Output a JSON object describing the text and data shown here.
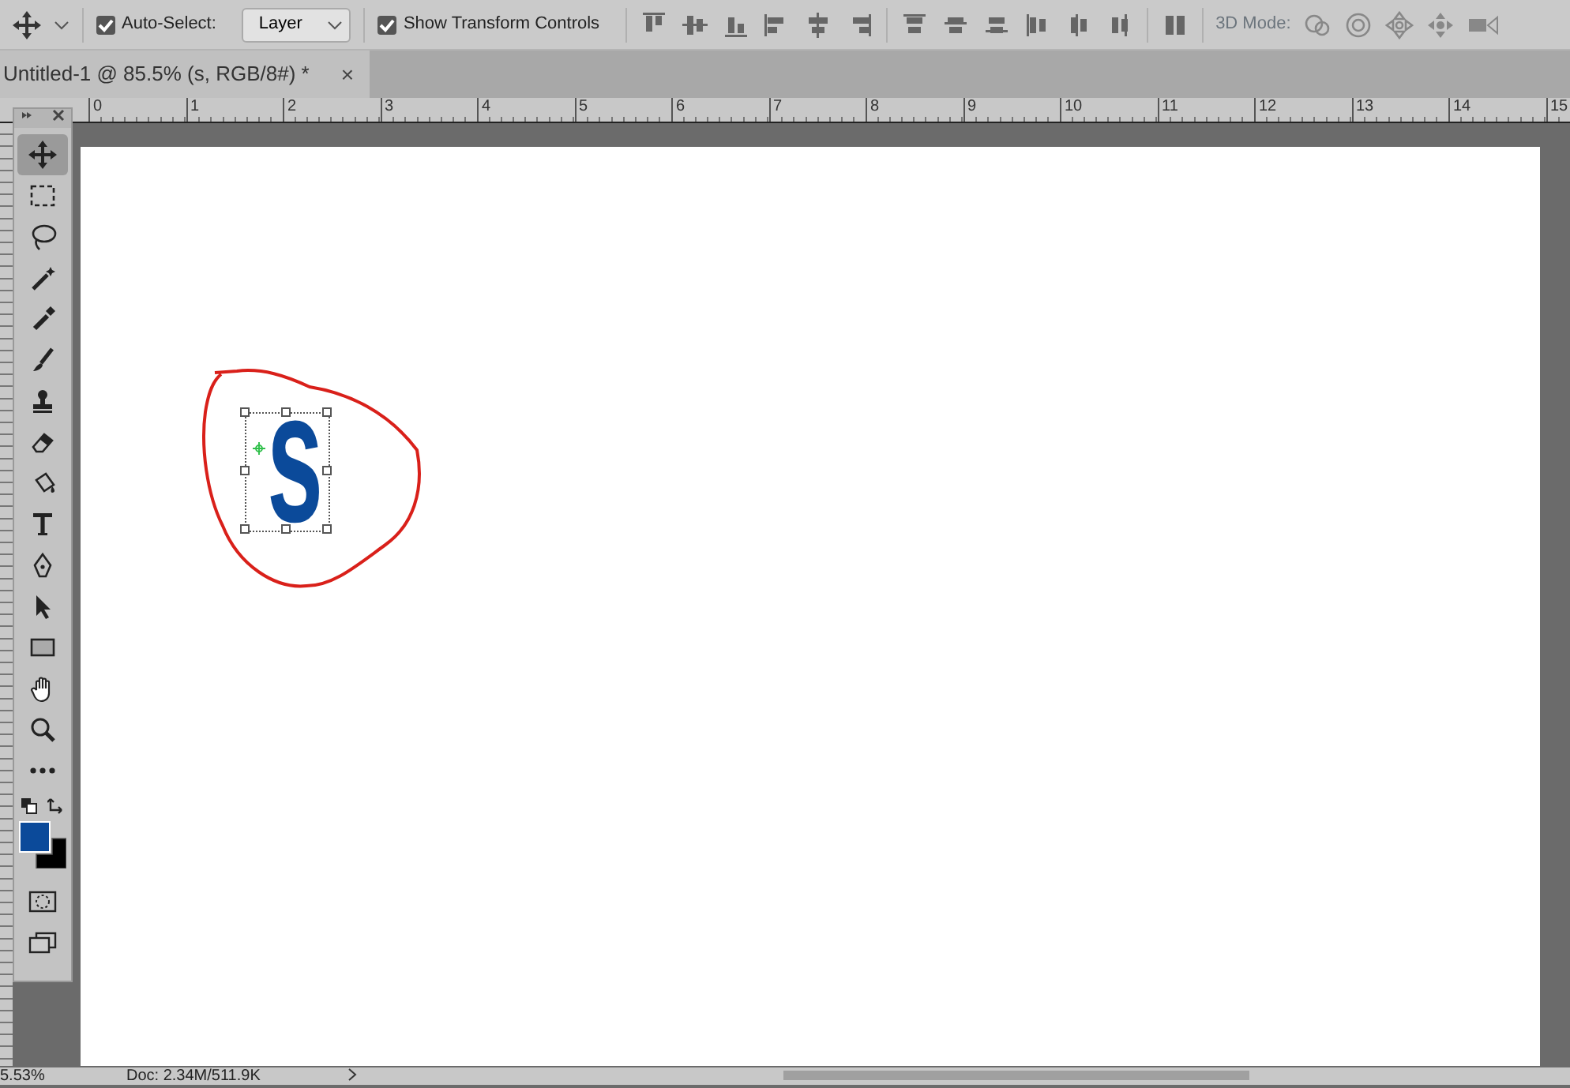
{
  "options_bar": {
    "auto_select": {
      "label": "Auto-Select:",
      "checked": true
    },
    "auto_select_target": "Layer",
    "show_transform": {
      "label": "Show Transform Controls",
      "checked": true
    },
    "mode_3d_label": "3D Mode:"
  },
  "document_tab": {
    "title": "Untitled-1 @ 85.5% (s, RGB/8#) *",
    "close": "×"
  },
  "ruler": {
    "labels": [
      "0",
      "1",
      "2",
      "3",
      "4",
      "5",
      "6",
      "7",
      "8",
      "9",
      "10",
      "11",
      "12",
      "13",
      "14",
      "15"
    ]
  },
  "tools": [
    {
      "kind": "move",
      "selected": true
    },
    {
      "kind": "marquee",
      "selected": false
    },
    {
      "kind": "lasso",
      "selected": false
    },
    {
      "kind": "wand",
      "selected": false
    },
    {
      "kind": "eyedropper",
      "selected": false
    },
    {
      "kind": "brush",
      "selected": false
    },
    {
      "kind": "stamp",
      "selected": false
    },
    {
      "kind": "eraser",
      "selected": false
    },
    {
      "kind": "bucket",
      "selected": false
    },
    {
      "kind": "type",
      "selected": false
    },
    {
      "kind": "pen",
      "selected": false
    },
    {
      "kind": "pointer",
      "selected": false
    },
    {
      "kind": "rectangle",
      "selected": false
    },
    {
      "kind": "hand",
      "selected": false
    },
    {
      "kind": "zoom",
      "selected": false
    },
    {
      "kind": "more",
      "selected": false
    }
  ],
  "color_swatches": [
    {
      "kind": "foreground",
      "color": "#0b4a9a"
    },
    {
      "kind": "background",
      "color": "#000000"
    }
  ],
  "canvas": {
    "text": "s"
  },
  "status_bar": {
    "zoom": "5.53%",
    "doc_info": "Doc: 2.34M/511.9K"
  }
}
